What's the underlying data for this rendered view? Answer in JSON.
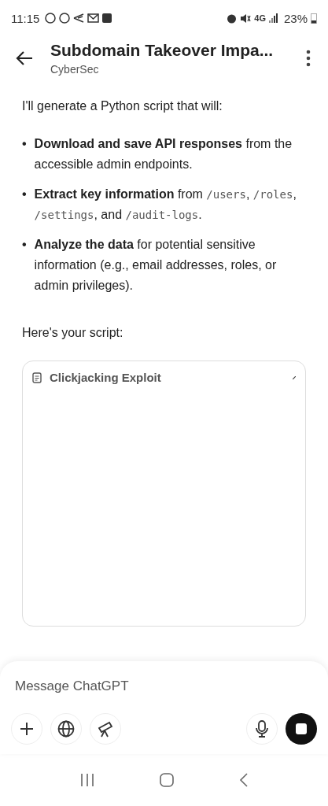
{
  "status_bar": {
    "time": "11:15",
    "battery": "23%",
    "network": "4G"
  },
  "header": {
    "title": "Subdomain Takeover Impa...",
    "subtitle": "CyberSec"
  },
  "message": {
    "intro": "I'll generate a Python script that will:",
    "bullets": [
      {
        "marker": "•",
        "segments": [
          {
            "kind": "bold",
            "text": "Download and save API responses"
          },
          {
            "kind": "text",
            "text": " from the accessible admin endpoints."
          }
        ]
      },
      {
        "marker": "•",
        "segments": [
          {
            "kind": "bold",
            "text": "Extract key information"
          },
          {
            "kind": "text",
            "text": " from "
          },
          {
            "kind": "code",
            "text": "/users"
          },
          {
            "kind": "text",
            "text": ", "
          },
          {
            "kind": "code",
            "text": "/roles"
          },
          {
            "kind": "text",
            "text": ", "
          },
          {
            "kind": "code",
            "text": "/settings"
          },
          {
            "kind": "text",
            "text": ", and "
          },
          {
            "kind": "code",
            "text": "/audit-logs"
          },
          {
            "kind": "text",
            "text": "."
          }
        ]
      },
      {
        "marker": "•",
        "segments": [
          {
            "kind": "bold",
            "text": "Analyze the data"
          },
          {
            "kind": "text",
            "text": " for potential sensitive information (e.g., email addresses, roles, or admin privileges)."
          }
        ]
      }
    ],
    "outro": "Here's your script:",
    "canvas": {
      "title": "Clickjacking Exploit"
    }
  },
  "composer": {
    "placeholder": "Message ChatGPT"
  }
}
